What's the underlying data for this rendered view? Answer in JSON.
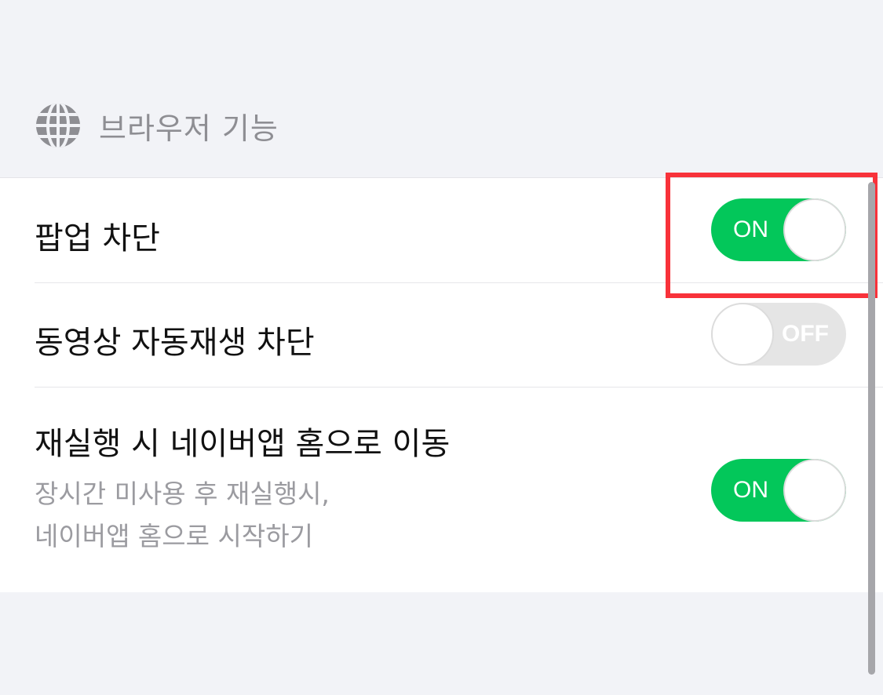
{
  "section": {
    "icon": "globe-icon",
    "title": "브라우저 기능"
  },
  "settings": [
    {
      "label": "팝업 차단",
      "toggle_state": "ON",
      "enabled": true
    },
    {
      "label": "동영상 자동재생 차단",
      "toggle_state": "OFF",
      "enabled": false
    },
    {
      "label": "재실행 시 네이버앱 홈으로 이동",
      "description_line1": "장시간 미사용 후 재실행시,",
      "description_line2": "네이버앱 홈으로 시작하기",
      "toggle_state": "ON",
      "enabled": true
    }
  ],
  "colors": {
    "toggle_on": "#03c75a",
    "toggle_off": "#e5e5e5",
    "highlight": "#f8323a",
    "background": "#f2f3f7"
  }
}
